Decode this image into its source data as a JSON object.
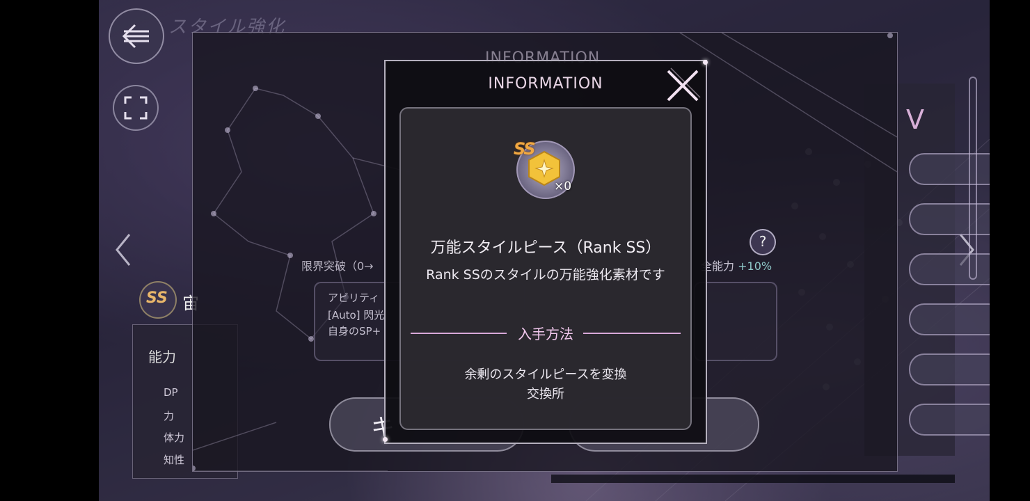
{
  "screen": {
    "title": "スタイル強化"
  },
  "background_panel": {
    "title": "INFORMATION",
    "limit_break_text": "限界突破（0→",
    "ability_label": "アビリティ",
    "ability_line2": "[Auto] 閃光",
    "ability_line3": "自身のSP+",
    "all_ability_label": "全能力",
    "all_ability_bonus": "+10%",
    "help_label": "?",
    "left_button_label": "キ",
    "rank_badge": "SS",
    "name_partial": "宙",
    "status_header": "能力",
    "status_rows": [
      "DP",
      "力",
      "体力",
      "知性"
    ]
  },
  "modal": {
    "title": "INFORMATION",
    "item": {
      "rank": "SS",
      "count": "×0",
      "name": "万能スタイルピース（Rank SS）",
      "description": "Rank SSのスタイルの万能強化素材です"
    },
    "acquisition": {
      "heading": "入手方法",
      "method": "余剰のスタイルピースを変換",
      "place": "交換所"
    }
  },
  "icons": {
    "back": "back-arrow-icon",
    "fullscreen": "fullscreen-icon",
    "close": "close-icon",
    "item": "style-piece-icon"
  },
  "colors": {
    "accent_pink": "#d8a8d8",
    "gold": "#f0a842",
    "bonus_teal": "#8ec8c8"
  }
}
